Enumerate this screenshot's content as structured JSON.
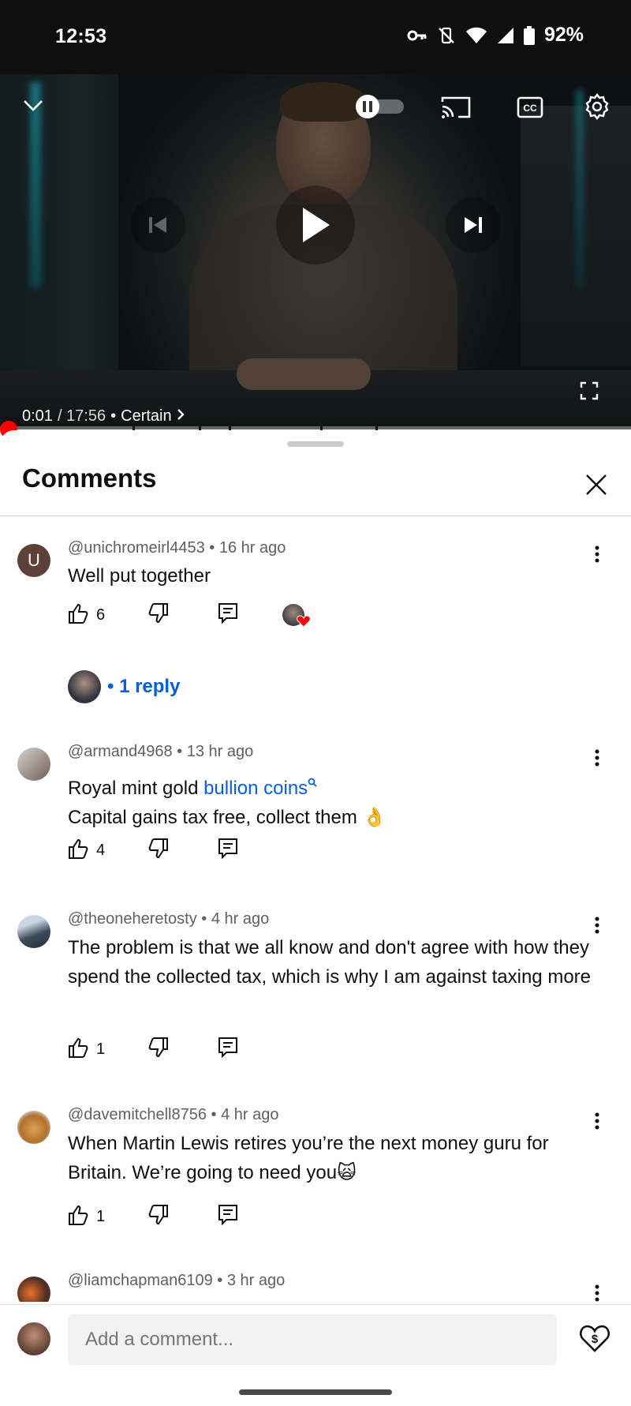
{
  "status_bar": {
    "time": "12:53",
    "battery": "92%"
  },
  "player": {
    "current_time": "0:01",
    "separator": " / ",
    "duration": "17:56",
    "chapter_dot": "•",
    "chapter": "Certain",
    "progress_fraction": 0.001,
    "icons": {
      "minimize": "chevron-down-icon",
      "autoplay": "autoplay-toggle-icon",
      "cast": "cast-icon",
      "captions": "cc-icon",
      "settings": "gear-icon",
      "previous": "previous-icon",
      "play": "play-icon",
      "next": "next-icon",
      "fullscreen": "fullscreen-icon"
    }
  },
  "comments_panel": {
    "title": "Comments",
    "comments": [
      {
        "avatar_letter": "U",
        "avatar_color": "#5d4037",
        "author": "@unichromeirl4453",
        "age": "16 hr ago",
        "text": "Well put together",
        "likes": "6",
        "creator_heart": true,
        "replies_label": "• 1 reply"
      },
      {
        "author": "@armand4968",
        "age": "13 hr ago",
        "text_before_link": "Royal mint gold ",
        "link_text": "bullion coins",
        "text_line2": "Capital gains tax free, collect them 👌",
        "likes": "4"
      },
      {
        "author": "@theoneheretosty",
        "age": "4 hr ago",
        "text": "The problem is that we all know and don't agree with how they spend the collected tax, which is why I am against taxing more",
        "likes": "1"
      },
      {
        "author": "@davemitchell8756",
        "age": "4 hr ago",
        "text": "When Martin Lewis retires you’re the next money guru for Britain. We’re going to need you🙀",
        "likes": "1"
      },
      {
        "author": "@liamchapman6109",
        "age": "3 hr ago"
      }
    ],
    "composer": {
      "placeholder": "Add a comment..."
    }
  },
  "colors": {
    "accent_red": "#ff0000",
    "link_blue": "#065fd4"
  }
}
